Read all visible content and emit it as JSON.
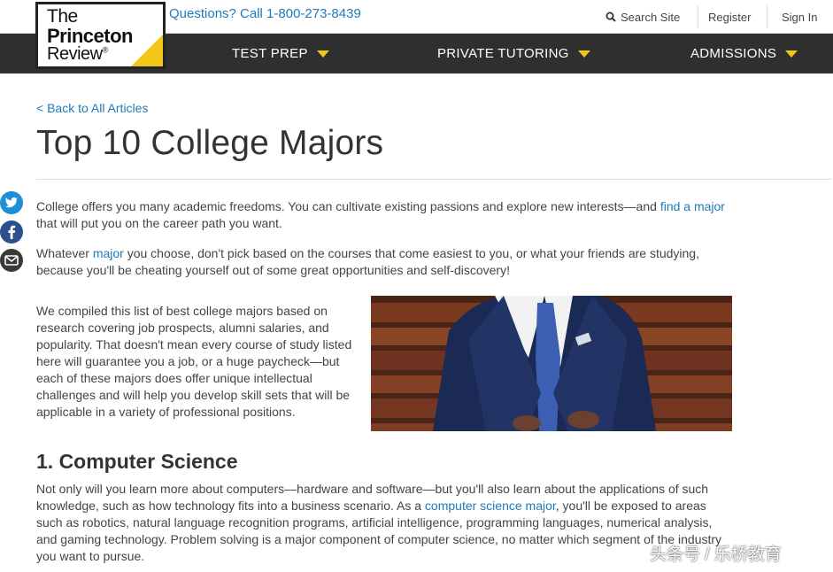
{
  "logo": {
    "line1": "The",
    "line2": "Princeton",
    "line3": "Review",
    "mark": "®"
  },
  "phone": "Questions? Call 1-800-273-8439",
  "utility": {
    "search_label": "Search Site",
    "register_label": "Register",
    "signin_label": "Sign In"
  },
  "nav": {
    "items": [
      {
        "label": "TEST PREP"
      },
      {
        "label": "PRIVATE TUTORING"
      },
      {
        "label": "ADMISSIONS"
      }
    ]
  },
  "article": {
    "back_link": "< Back to All Articles",
    "title": "Top 10 College Majors",
    "p1_a": "College offers you many academic freedoms. You can cultivate existing passions and explore new interests—and ",
    "p1_link": "find a major",
    "p1_b": " that will put you on the career path you want.",
    "p2_a": "Whatever ",
    "p2_link": "major",
    "p2_b": " you choose, don't pick based on the courses that come easiest to you, or what your friends are studying, because you'll be cheating yourself out of some great opportunities and self-discovery!",
    "p3": "We compiled this list of best college majors based on research covering job prospects, alumni salaries, and popularity. That doesn't mean every course of study listed here will guarantee you a job, or a huge paycheck—but each of these majors does offer unique intellectual challenges and will help you develop skill sets that will be applicable in a variety of professional positions.",
    "section_title": "1. Computer Science",
    "p4_a": "Not only will you learn more about computers—hardware and software—but you'll also learn about the applications of such knowledge, such as how technology fits into a business scenario. As a ",
    "p4_link": "computer science major",
    "p4_b": ", you'll be exposed to areas such as robotics, natural language recognition programs, artificial intelligence, programming languages, numerical analysis, and gaming technology. Problem solving is a major component of computer science, no matter which segment of the industry you want to pursue."
  },
  "social": [
    "twitter-icon",
    "facebook-icon",
    "email-icon"
  ],
  "watermark": "头条号 / 乐桥教育",
  "colors": {
    "accent_yellow": "#f2c618",
    "nav_bg": "#2f2f2f",
    "link_blue": "#1f7ab8"
  }
}
